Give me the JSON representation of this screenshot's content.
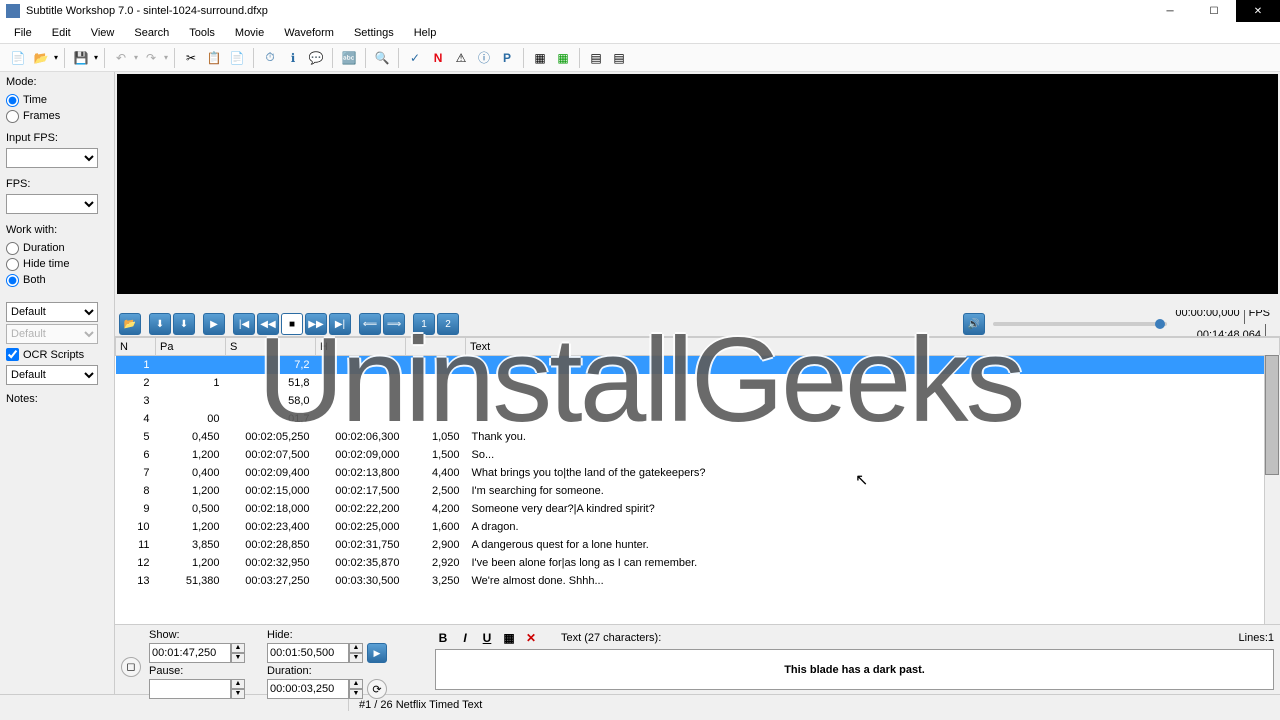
{
  "window": {
    "title": "Subtitle Workshop 7.0 - sintel-1024-surround.dfxp"
  },
  "menu": [
    "File",
    "Edit",
    "View",
    "Search",
    "Tools",
    "Movie",
    "Waveform",
    "Settings",
    "Help"
  ],
  "left": {
    "mode_label": "Mode:",
    "mode_time": "Time",
    "mode_frames": "Frames",
    "input_fps_label": "Input FPS:",
    "fps_label": "FPS:",
    "work_with_label": "Work with:",
    "ww_duration": "Duration",
    "ww_hide": "Hide time",
    "ww_both": "Both",
    "default1": "Default",
    "default2": "Default",
    "ocr_label": "OCR Scripts",
    "default3": "Default",
    "notes_label": "Notes:"
  },
  "player": {
    "pos": "00:00:00,000",
    "dur": "00:14:48,064",
    "fps_label": "FPS"
  },
  "grid": {
    "headers": [
      "N",
      "Pa",
      "S",
      "H",
      "",
      "Text"
    ],
    "rows": [
      {
        "n": 1,
        "pa": "",
        "s": "7,2",
        "h": "",
        "d": "",
        "t": "",
        "sel": true
      },
      {
        "n": 2,
        "pa": "1",
        "s": "51,8",
        "h": "",
        "d": "",
        "t": ""
      },
      {
        "n": 3,
        "pa": "",
        "s": "58,0",
        "h": "",
        "d": "",
        "t": ""
      },
      {
        "n": 4,
        "pa": "00",
        "s": "01,7",
        "h": "",
        "d": "",
        "t": ""
      },
      {
        "n": 5,
        "pa": "0,450",
        "s": "00:02:05,250",
        "h": "00:02:06,300",
        "d": "1,050",
        "t": "Thank you."
      },
      {
        "n": 6,
        "pa": "1,200",
        "s": "00:02:07,500",
        "h": "00:02:09,000",
        "d": "1,500",
        "t": "So..."
      },
      {
        "n": 7,
        "pa": "0,400",
        "s": "00:02:09,400",
        "h": "00:02:13,800",
        "d": "4,400",
        "t": "What brings you to|the land of the gatekeepers?"
      },
      {
        "n": 8,
        "pa": "1,200",
        "s": "00:02:15,000",
        "h": "00:02:17,500",
        "d": "2,500",
        "t": "I'm searching for someone."
      },
      {
        "n": 9,
        "pa": "0,500",
        "s": "00:02:18,000",
        "h": "00:02:22,200",
        "d": "4,200",
        "t": "Someone very dear?|A kindred spirit?"
      },
      {
        "n": 10,
        "pa": "1,200",
        "s": "00:02:23,400",
        "h": "00:02:25,000",
        "d": "1,600",
        "t": "A dragon."
      },
      {
        "n": 11,
        "pa": "3,850",
        "s": "00:02:28,850",
        "h": "00:02:31,750",
        "d": "2,900",
        "t": "A dangerous quest for a lone hunter."
      },
      {
        "n": 12,
        "pa": "1,200",
        "s": "00:02:32,950",
        "h": "00:02:35,870",
        "d": "2,920",
        "t": "I've been alone for|as long as I can remember."
      },
      {
        "n": 13,
        "pa": "51,380",
        "s": "00:03:27,250",
        "h": "00:03:30,500",
        "d": "3,250",
        "t": "We're almost done. Shhh..."
      }
    ]
  },
  "editor": {
    "show_label": "Show:",
    "hide_label": "Hide:",
    "pause_label": "Pause:",
    "duration_label": "Duration:",
    "show_val": "00:01:47,250",
    "hide_val": "00:01:50,500",
    "pause_val": "",
    "duration_val": "00:00:03,250",
    "text_label": "Text (27 characters):",
    "text_value": "This blade has a dark past.",
    "lines": "Lines:1"
  },
  "status": {
    "pos": "#1 / 26",
    "format": "Netflix Timed Text"
  },
  "watermark": "UninstallGeeks"
}
